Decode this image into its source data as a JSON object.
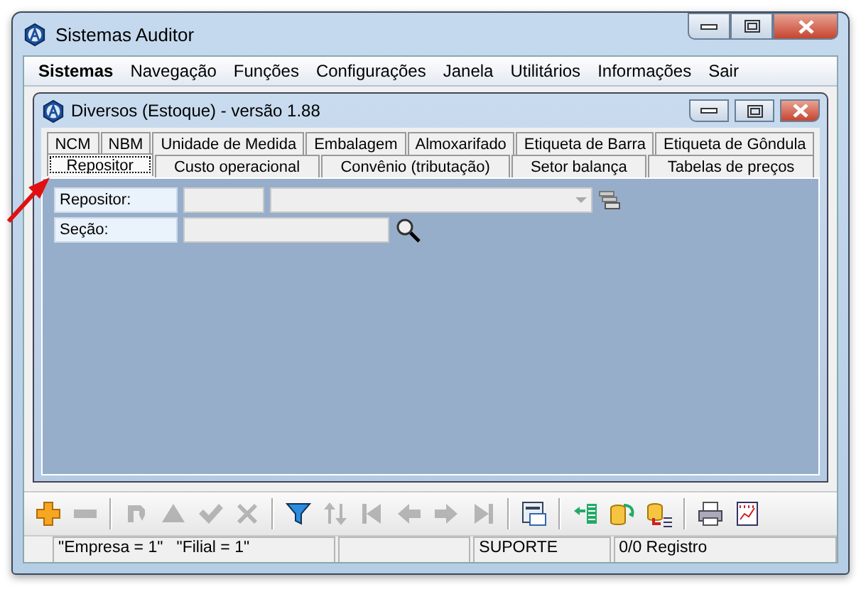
{
  "window": {
    "title": "Sistemas Auditor"
  },
  "menu": [
    {
      "label": "Sistemas",
      "bold": true
    },
    {
      "label": "Navegação",
      "bold": false
    },
    {
      "label": "Funções",
      "bold": false
    },
    {
      "label": "Configurações",
      "bold": false
    },
    {
      "label": "Janela",
      "bold": false
    },
    {
      "label": "Utilitários",
      "bold": false
    },
    {
      "label": "Informações",
      "bold": false
    },
    {
      "label": "Sair",
      "bold": false
    }
  ],
  "child_window": {
    "title": "Diversos (Estoque) - versão 1.88",
    "tab_rows": [
      [
        {
          "label": "NCM",
          "selected": false
        },
        {
          "label": "NBM",
          "selected": false
        },
        {
          "label": "Unidade de Medida",
          "selected": false
        },
        {
          "label": "Embalagem",
          "selected": false
        },
        {
          "label": "Almoxarifado",
          "selected": false
        },
        {
          "label": "Etiqueta de Barra",
          "selected": false
        },
        {
          "label": "Etiqueta de Gôndula",
          "selected": false
        }
      ],
      [
        {
          "label": "Repositor",
          "selected": true
        },
        {
          "label": "Custo operacional",
          "selected": false
        },
        {
          "label": "Convênio (tributação)",
          "selected": false
        },
        {
          "label": "Setor balança",
          "selected": false
        },
        {
          "label": "Tabelas de preços",
          "selected": false
        }
      ]
    ],
    "form": [
      {
        "label": "Repositor:",
        "kind": "combo"
      },
      {
        "label": "Seção:",
        "kind": "search"
      }
    ]
  },
  "toolbar": [
    {
      "kind": "plus",
      "disabled": false
    },
    {
      "kind": "minus",
      "disabled": true
    },
    {
      "kind": "sep"
    },
    {
      "kind": "refresh",
      "disabled": true
    },
    {
      "kind": "up",
      "disabled": true
    },
    {
      "kind": "check",
      "disabled": true
    },
    {
      "kind": "cross",
      "disabled": true
    },
    {
      "kind": "sep"
    },
    {
      "kind": "filter",
      "disabled": false
    },
    {
      "kind": "sort",
      "disabled": true
    },
    {
      "kind": "first",
      "disabled": true
    },
    {
      "kind": "prev",
      "disabled": true
    },
    {
      "kind": "next",
      "disabled": true
    },
    {
      "kind": "last",
      "disabled": true
    },
    {
      "kind": "sep"
    },
    {
      "kind": "form",
      "disabled": false
    },
    {
      "kind": "sep"
    },
    {
      "kind": "import",
      "disabled": false
    },
    {
      "kind": "database",
      "disabled": false
    },
    {
      "kind": "dblist",
      "disabled": false
    },
    {
      "kind": "sep"
    },
    {
      "kind": "printer",
      "disabled": false
    },
    {
      "kind": "chart",
      "disabled": false
    }
  ],
  "status_bar": [
    "\"Empresa = 1\"   \"Filial = 1\"",
    "SUPORTE",
    "0/0 Registro"
  ]
}
